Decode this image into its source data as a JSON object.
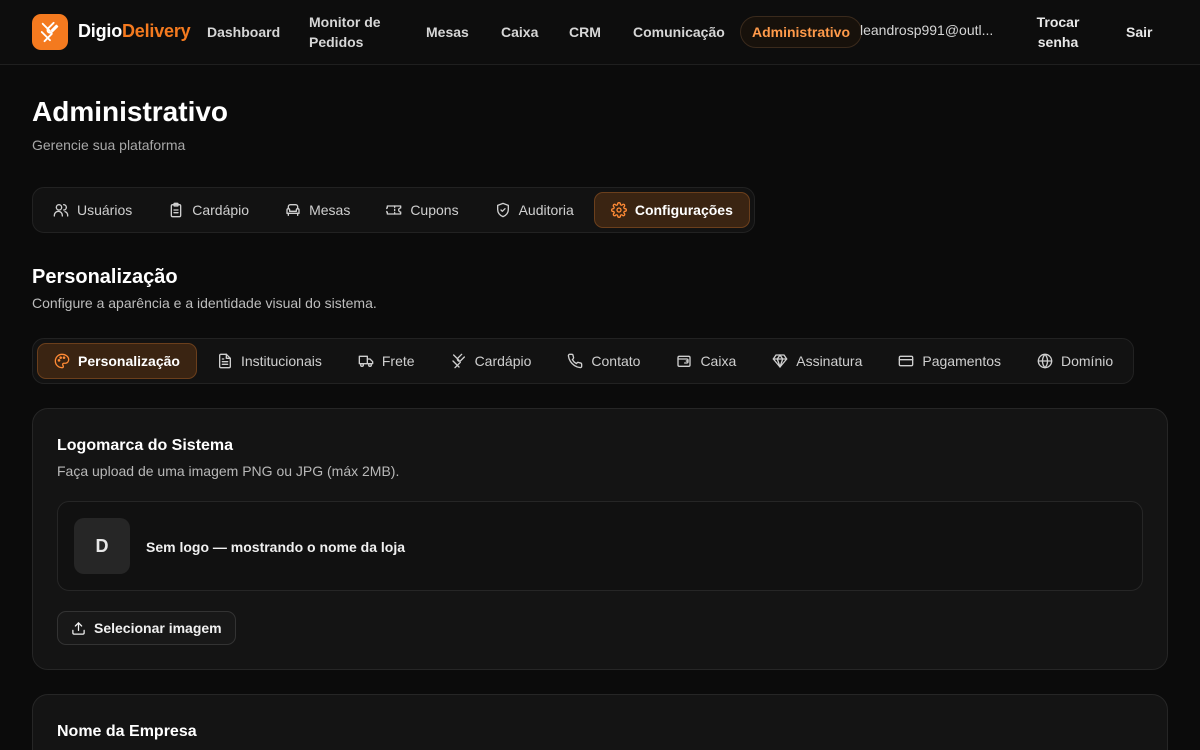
{
  "brand": {
    "part1": "Digio",
    "part2": "Delivery",
    "accent_color": "#f47a1f",
    "icon": "utensils-icon"
  },
  "nav": {
    "items": [
      "Dashboard",
      "Monitor de Pedidos",
      "Mesas",
      "Caixa",
      "CRM",
      "Comunicação"
    ],
    "active": "Administrativo",
    "user_email": "leandrosp991@outl...",
    "change_password": "Trocar senha",
    "logout": "Sair"
  },
  "page": {
    "title": "Administrativo",
    "subtitle": "Gerencie sua plataforma"
  },
  "admin_tabs": [
    {
      "label": "Usuários",
      "icon": "users-icon"
    },
    {
      "label": "Cardápio",
      "icon": "clipboard-icon"
    },
    {
      "label": "Mesas",
      "icon": "armchair-icon"
    },
    {
      "label": "Cupons",
      "icon": "ticket-icon"
    },
    {
      "label": "Auditoria",
      "icon": "shield-icon"
    },
    {
      "label": "Configurações",
      "icon": "gear-icon",
      "active": true
    }
  ],
  "section": {
    "title": "Personalização",
    "subtitle": "Configure a aparência e a identidade visual do sistema."
  },
  "settings_tabs": [
    {
      "label": "Personalização",
      "icon": "palette-icon",
      "active": true
    },
    {
      "label": "Institucionais",
      "icon": "file-text-icon"
    },
    {
      "label": "Frete",
      "icon": "truck-icon"
    },
    {
      "label": "Cardápio",
      "icon": "utensils-icon"
    },
    {
      "label": "Contato",
      "icon": "phone-icon"
    },
    {
      "label": "Caixa",
      "icon": "wallet-icon"
    },
    {
      "label": "Assinatura",
      "icon": "gem-icon"
    },
    {
      "label": "Pagamentos",
      "icon": "credit-card-icon"
    },
    {
      "label": "Domínio",
      "icon": "globe-icon"
    }
  ],
  "logo_card": {
    "title": "Logomarca do Sistema",
    "subtitle": "Faça upload de uma imagem PNG ou JPG (máx 2MB).",
    "avatar_letter": "D",
    "preview_text": "Sem logo — mostrando o nome da loja",
    "upload_label": "Selecionar imagem"
  },
  "company_card": {
    "title": "Nome da Empresa"
  }
}
